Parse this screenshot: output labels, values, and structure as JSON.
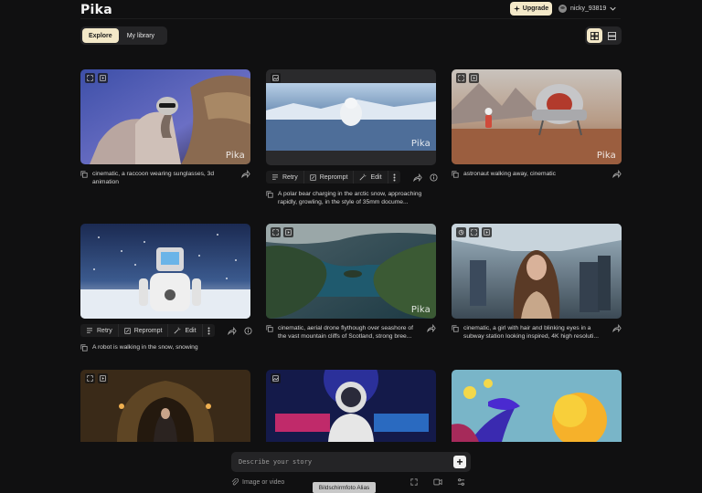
{
  "brand": {
    "logo": "Pika"
  },
  "header": {
    "upgrade_label": "Upgrade",
    "username": "nicky_93819"
  },
  "tabs": [
    {
      "label": "Explore",
      "active": true
    },
    {
      "label": "My library",
      "active": false
    }
  ],
  "view_toggle": {
    "grid": "grid-view-icon",
    "list": "list-view-icon"
  },
  "watermark": "Pika",
  "actions": {
    "retry": "Retry",
    "reprompt": "Reprompt",
    "edit": "Edit"
  },
  "cards": [
    {
      "caption": "cinematic, a raccoon wearing sunglasses, 3d animation"
    },
    {
      "caption": "A polar bear charging in the arctic snow, approaching rapidly, growling, in the style of 35mm docume..."
    },
    {
      "caption": "astronaut walking away, cinematic"
    },
    {
      "caption": "A robot is walking in the snow, snowing"
    },
    {
      "caption": "cinematic, aerial drone flythough over seashore of the vast mountain cliffs of Scotland, strong bree..."
    },
    {
      "caption": "cinematic, a girl with hair and blinking eyes in a subway station looking inspired, 4K high resoluti..."
    }
  ],
  "prompt": {
    "placeholder": "Describe your story",
    "attach_label": "Image or video"
  },
  "tooltip": "Bildschirmfoto Alias",
  "colors": {
    "accent": "#f3e8c8",
    "background": "#101011",
    "panel": "#252527"
  }
}
